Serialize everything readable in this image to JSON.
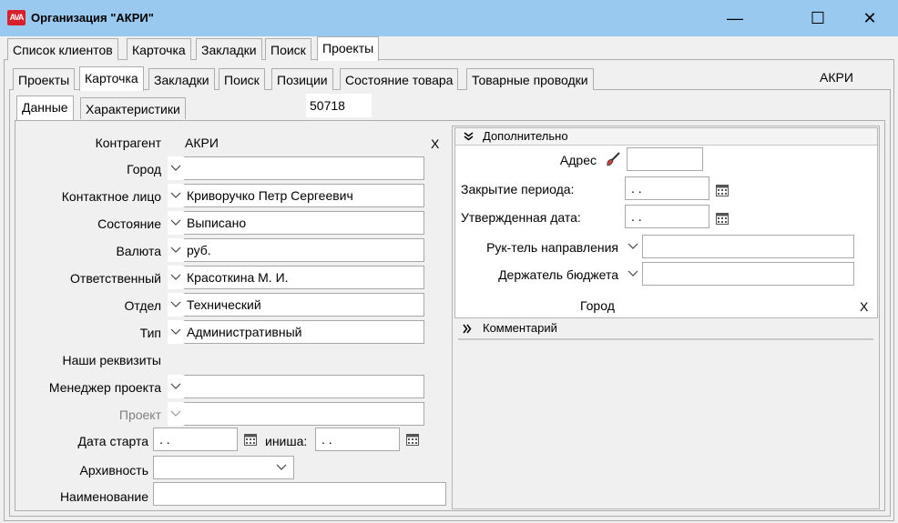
{
  "window": {
    "icon_text": "AVA",
    "title": "Организация \"АКРИ\"",
    "minimize": "—",
    "maximize": "☐",
    "close": "✕"
  },
  "tabs_top": [
    "Список клиентов",
    "Карточка",
    "Закладки",
    "Поиск",
    "Проекты"
  ],
  "tabs_mid": [
    "Проекты",
    "Карточка",
    "Закладки",
    "Поиск",
    "Позиции",
    "Состояние товара",
    "Товарные проводки"
  ],
  "tabs_inner": [
    "Данные",
    "Характеристики"
  ],
  "header": {
    "org": "АКРИ",
    "number": "50718"
  },
  "form": {
    "contragent_label": "Контрагент",
    "contragent_value": "АКРИ",
    "clear": "X",
    "city_label": "Город",
    "city_value": "",
    "contact_label": "Контактное лицо",
    "contact_value": "Криворучко Петр Сергеевич",
    "state_label": "Состояние",
    "state_value": "Выписано",
    "currency_label": "Валюта",
    "currency_value": "руб.",
    "responsible_label": "Ответственный",
    "responsible_value": "Красоткина М. И.",
    "dept_label": "Отдел",
    "dept_value": "Технический",
    "type_label": "Тип",
    "type_value": "Административный",
    "our_req": "Наши реквизиты",
    "manager_label": "Менеджер проекта",
    "project_label": "Проект",
    "start_label": "Дата старта",
    "start_value": ". .",
    "finish_label": "иниша:",
    "finish_value": ". .",
    "archive_label": "Архивность",
    "name_label": "Наименование"
  },
  "extra": {
    "section_title": "Дополнительно",
    "address_label": "Адрес",
    "period_close_label": "Закрытие периода:",
    "period_close_value": ". .",
    "approved_label": "Утвержденная дата:",
    "approved_value": ". .",
    "direction_head_label": "Рук-тель направления",
    "budget_holder_label": "Держатель бюджета",
    "city_label": "Город",
    "clear": "X",
    "comment_title": "Комментарий"
  }
}
